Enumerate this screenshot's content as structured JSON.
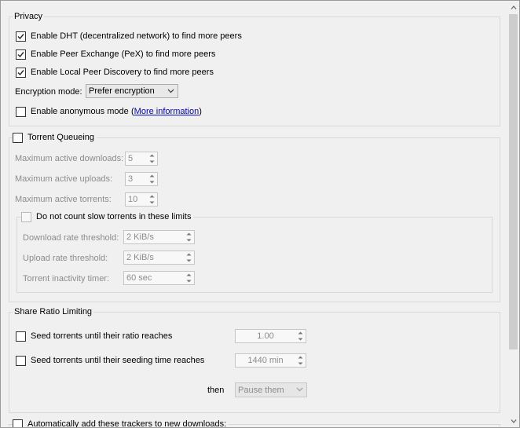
{
  "privacy": {
    "title": "Privacy",
    "dht_label": "Enable DHT (decentralized network) to find more peers",
    "dht_checked": true,
    "pex_label": "Enable Peer Exchange (PeX) to find more peers",
    "pex_checked": true,
    "lpd_label": "Enable Local Peer Discovery to find more peers",
    "lpd_checked": true,
    "encryption_label": "Encryption mode:",
    "encryption_value": "Prefer encryption",
    "anonymous_label": "Enable anonymous mode",
    "anonymous_checked": false,
    "more_info_open": "(",
    "more_info_link": "More information",
    "more_info_close": ")"
  },
  "queueing": {
    "title": "Torrent Queueing",
    "checked": false,
    "max_downloads_label": "Maximum active downloads:",
    "max_downloads_value": "5",
    "max_uploads_label": "Maximum active uploads:",
    "max_uploads_value": "3",
    "max_torrents_label": "Maximum active torrents:",
    "max_torrents_value": "10",
    "slow": {
      "title": "Do not count slow torrents in these limits",
      "checked": false,
      "download_label": "Download rate threshold:",
      "download_value": "2 KiB/s",
      "upload_label": "Upload rate threshold:",
      "upload_value": "2 KiB/s",
      "inactivity_label": "Torrent inactivity timer:",
      "inactivity_value": "60 sec"
    }
  },
  "share_ratio": {
    "title": "Share Ratio Limiting",
    "ratio_label": "Seed torrents until their ratio reaches",
    "ratio_checked": false,
    "ratio_value": "1.00",
    "time_label": "Seed torrents until their seeding time reaches",
    "time_checked": false,
    "time_value": "1440 min",
    "then_label": "then",
    "then_value": "Pause them"
  },
  "trackers": {
    "label": "Automatically add these trackers to new downloads:",
    "checked": false
  },
  "icons": {
    "check": "checkmark-icon",
    "dropdown": "chevron-down-icon",
    "spin_up": "spin-up-arrow-icon",
    "spin_down": "spin-down-arrow-icon"
  }
}
